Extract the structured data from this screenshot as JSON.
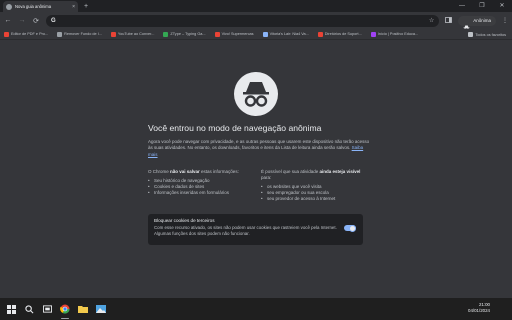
{
  "tab": {
    "title": "Nova guia anônima",
    "close": "×"
  },
  "new_tab": "+",
  "window_controls": {
    "minimize": "—",
    "maximize": "❐",
    "close": "✕"
  },
  "toolbar": {
    "back": "←",
    "forward": "→",
    "reload": "⟳",
    "omnibox_g": "G",
    "omnibox_value": "",
    "star": "☆",
    "incognito_label": "Anônima"
  },
  "bookmarks": [
    {
      "label": "Editor de PDF e Pro...",
      "color": "#ea4335"
    },
    {
      "label": "Remover Fundo de I...",
      "color": "#9aa0a6"
    },
    {
      "label": "YouTube ao Conver...",
      "color": "#ea4335"
    },
    {
      "label": "ZType – Typing Ga...",
      "color": "#34a853"
    },
    {
      "label": "Vivo! Supermercas",
      "color": "#ea4335"
    },
    {
      "label": "Vitoria's Lair: Nia4 Va...",
      "color": "#8ab4f8"
    },
    {
      "label": "Diretórios de Suport...",
      "color": "#ea4335"
    },
    {
      "label": "Início | Positivo Educa...",
      "color": "#a142f4"
    }
  ],
  "bookmarks_all": "Todos os favoritos",
  "incognito": {
    "heading": "Você entrou no modo de navegação anônima",
    "intro": "Agora você pode navegar com privacidade, e as outras pessoas que usarem este dispositivo não terão acesso às suas atividades. No entanto, os downloads, favoritos e itens da Lista de leitura ainda serão salvos.",
    "learn_more": "Saiba mais",
    "left_pre": "O Chrome ",
    "left_bold": "não vai salvar",
    "left_post": " estas informações:",
    "left_items": [
      "Seu histórico de navegação",
      "Cookies e dados de sites",
      "Informações inseridas em formulários"
    ],
    "right_pre": "É possível que sua atividade ",
    "right_bold": "ainda esteja visível",
    "right_post": " para:",
    "right_items": [
      "os websites que você visita",
      "seu empregador ou sua escola",
      "seu provedor de acesso à Internet"
    ],
    "cookie_title": "Bloquear cookies de terceiros",
    "cookie_desc": "Com esse recurso ativado, os sites não podem usar cookies que rastreiem você pela Internet. Algumas funções dos sites podem não funcionar.",
    "cookie_toggle_on": true
  },
  "taskbar": {
    "time": "21:00",
    "date": "04/01/2024"
  },
  "colors": {
    "accent": "#8ab4f8",
    "background": "#35363a"
  }
}
